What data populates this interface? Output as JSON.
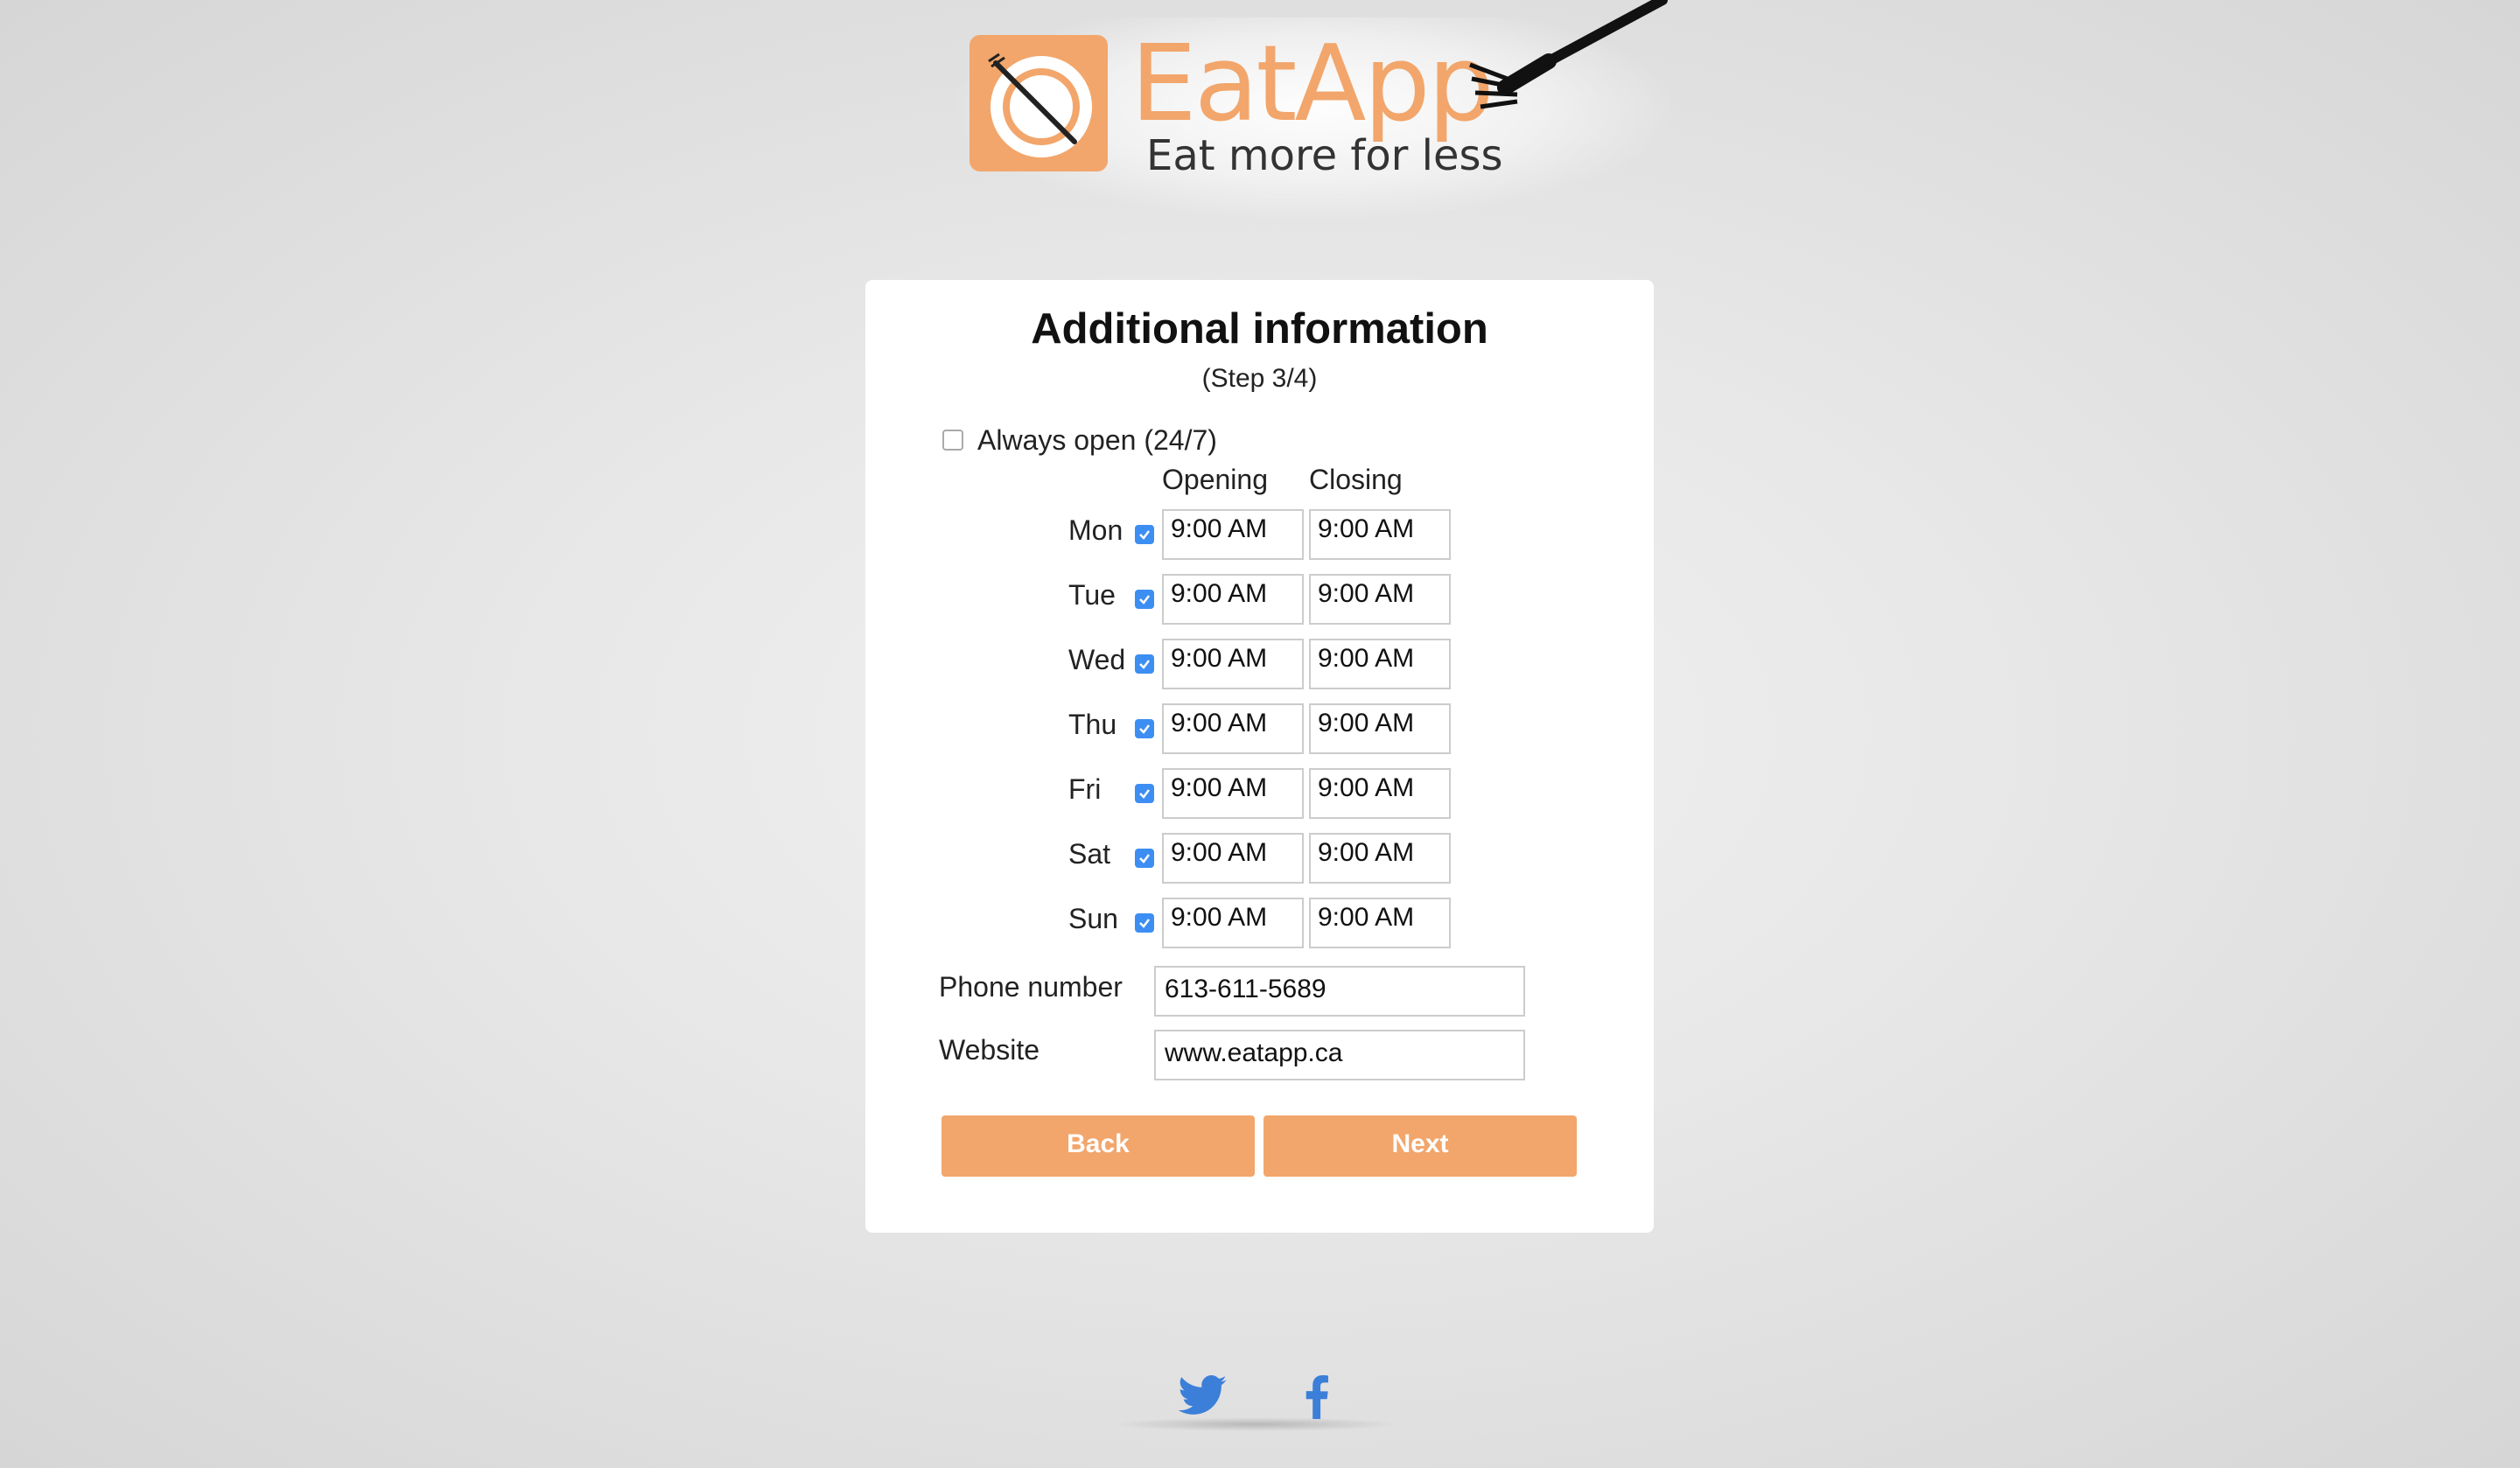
{
  "brand": {
    "name": "EatApp",
    "tagline": "Eat more for less",
    "color": "#f2a66b"
  },
  "form": {
    "title": "Additional information",
    "step": "(Step 3/4)",
    "always_open": {
      "label": "Always open (24/7)",
      "checked": false
    },
    "columns": {
      "opening": "Opening",
      "closing": "Closing"
    },
    "days": [
      {
        "label": "Mon",
        "checked": true,
        "opening": "9:00 AM",
        "closing": "9:00 AM"
      },
      {
        "label": "Tue",
        "checked": true,
        "opening": "9:00 AM",
        "closing": "9:00 AM"
      },
      {
        "label": "Wed",
        "checked": true,
        "opening": "9:00 AM",
        "closing": "9:00 AM"
      },
      {
        "label": "Thu",
        "checked": true,
        "opening": "9:00 AM",
        "closing": "9:00 AM"
      },
      {
        "label": "Fri",
        "checked": true,
        "opening": "9:00 AM",
        "closing": "9:00 AM"
      },
      {
        "label": "Sat",
        "checked": true,
        "opening": "9:00 AM",
        "closing": "9:00 AM"
      },
      {
        "label": "Sun",
        "checked": true,
        "opening": "9:00 AM",
        "closing": "9:00 AM"
      }
    ],
    "phone": {
      "label": "Phone number",
      "value": "613-611-5689"
    },
    "website": {
      "label": "Website",
      "value": "www.eatapp.ca"
    },
    "back_label": "Back",
    "next_label": "Next",
    "accent": "#f2a66b",
    "check_color": "#3d8ef2"
  },
  "footer": {
    "icons": [
      "twitter-icon",
      "facebook-icon"
    ],
    "icon_color": "#3b7fd9"
  }
}
